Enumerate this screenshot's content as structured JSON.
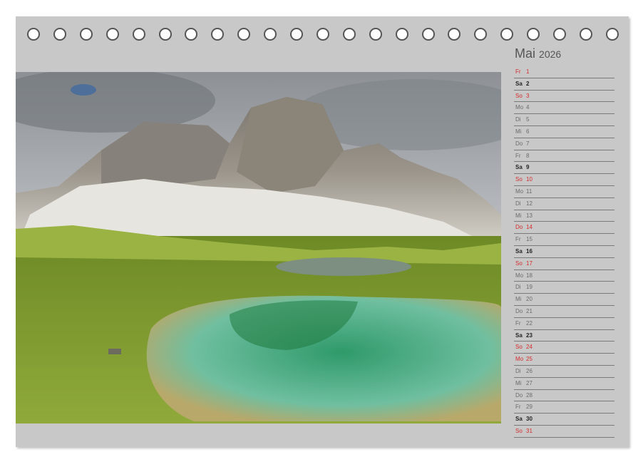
{
  "calendar": {
    "month": "Mai",
    "year": "2026",
    "days": [
      {
        "wd": "Fr",
        "num": "1",
        "kind": "holiday"
      },
      {
        "wd": "Sa",
        "num": "2",
        "kind": "sat"
      },
      {
        "wd": "So",
        "num": "3",
        "kind": "sun"
      },
      {
        "wd": "Mo",
        "num": "4",
        "kind": "week"
      },
      {
        "wd": "Di",
        "num": "5",
        "kind": "week"
      },
      {
        "wd": "Mi",
        "num": "6",
        "kind": "week"
      },
      {
        "wd": "Do",
        "num": "7",
        "kind": "week"
      },
      {
        "wd": "Fr",
        "num": "8",
        "kind": "week"
      },
      {
        "wd": "Sa",
        "num": "9",
        "kind": "sat"
      },
      {
        "wd": "So",
        "num": "10",
        "kind": "sun"
      },
      {
        "wd": "Mo",
        "num": "11",
        "kind": "week"
      },
      {
        "wd": "Di",
        "num": "12",
        "kind": "week"
      },
      {
        "wd": "Mi",
        "num": "13",
        "kind": "week"
      },
      {
        "wd": "Do",
        "num": "14",
        "kind": "holiday"
      },
      {
        "wd": "Fr",
        "num": "15",
        "kind": "week"
      },
      {
        "wd": "Sa",
        "num": "16",
        "kind": "sat"
      },
      {
        "wd": "So",
        "num": "17",
        "kind": "sun"
      },
      {
        "wd": "Mo",
        "num": "18",
        "kind": "week"
      },
      {
        "wd": "Di",
        "num": "19",
        "kind": "week"
      },
      {
        "wd": "Mi",
        "num": "20",
        "kind": "week"
      },
      {
        "wd": "Do",
        "num": "21",
        "kind": "week"
      },
      {
        "wd": "Fr",
        "num": "22",
        "kind": "week"
      },
      {
        "wd": "Sa",
        "num": "23",
        "kind": "sat"
      },
      {
        "wd": "So",
        "num": "24",
        "kind": "sun"
      },
      {
        "wd": "Mo",
        "num": "25",
        "kind": "holiday"
      },
      {
        "wd": "Di",
        "num": "26",
        "kind": "week"
      },
      {
        "wd": "Mi",
        "num": "27",
        "kind": "week"
      },
      {
        "wd": "Do",
        "num": "28",
        "kind": "week"
      },
      {
        "wd": "Fr",
        "num": "29",
        "kind": "week"
      },
      {
        "wd": "Sa",
        "num": "30",
        "kind": "sat"
      },
      {
        "wd": "So",
        "num": "31",
        "kind": "sun"
      }
    ]
  },
  "colors": {
    "page": "#c8c8c8",
    "sunday_holiday": "#d42b2b",
    "saturday": "#222222",
    "weekday": "#6b6b6b"
  },
  "photo": {
    "subject": "mountain-lake-landscape"
  }
}
